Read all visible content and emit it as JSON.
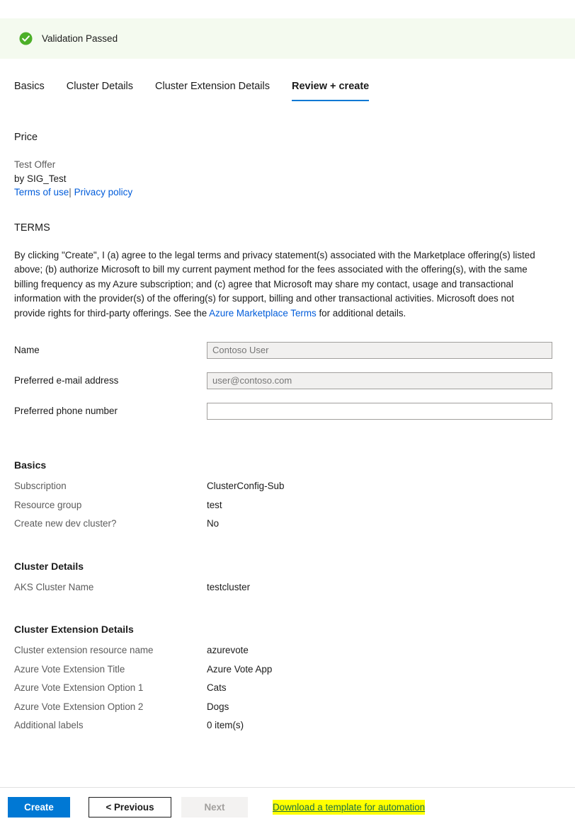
{
  "banner": {
    "icon": "check-circle-icon",
    "message": "Validation Passed",
    "background_color": "#f4faef",
    "icon_color": "#4caf28"
  },
  "tabs": [
    {
      "label": "Basics",
      "active": false
    },
    {
      "label": "Cluster Details",
      "active": false
    },
    {
      "label": "Cluster Extension Details",
      "active": false
    },
    {
      "label": "Review + create",
      "active": true
    }
  ],
  "accent_color": "#0078d4",
  "price": {
    "heading": "Price",
    "offer_name": "Test Offer",
    "publisher": "by SIG_Test",
    "terms_of_use_link": "Terms of use",
    "separator": "|",
    "privacy_policy_link": "Privacy policy"
  },
  "terms": {
    "heading": "TERMS",
    "paragraph_part1": "By clicking \"Create\", I (a) agree to the legal terms and privacy statement(s) associated with the Marketplace offering(s) listed above; (b) authorize Microsoft to bill my current payment method for the fees associated with the offering(s), with the same billing frequency as my Azure subscription; and (c) agree that Microsoft may share my contact, usage and transactional information with the provider(s) of the offering(s) for support, billing and other transactional activities. Microsoft does not provide rights for third-party offerings. See the ",
    "marketplace_terms_link": "Azure Marketplace Terms",
    "paragraph_part2": " for additional details."
  },
  "form": {
    "fields": [
      {
        "label": "Name",
        "value": "",
        "placeholder": "Contoso User",
        "readonly": true
      },
      {
        "label": "Preferred e-mail address",
        "value": "",
        "placeholder": "user@contoso.com",
        "readonly": true
      },
      {
        "label": "Preferred phone number",
        "value": "",
        "placeholder": "",
        "readonly": false
      }
    ]
  },
  "summary": {
    "sections": [
      {
        "title": "Basics",
        "rows": [
          {
            "key": "Subscription",
            "value": "ClusterConfig-Sub"
          },
          {
            "key": "Resource group",
            "value": "test"
          },
          {
            "key": "Create new dev cluster?",
            "value": "No"
          }
        ]
      },
      {
        "title": "Cluster Details",
        "rows": [
          {
            "key": "AKS Cluster Name",
            "value": "testcluster"
          }
        ]
      },
      {
        "title": "Cluster Extension Details",
        "rows": [
          {
            "key": "Cluster extension resource name",
            "value": "azurevote"
          },
          {
            "key": "Azure Vote Extension Title",
            "value": "Azure Vote App"
          },
          {
            "key": "Azure Vote Extension Option 1",
            "value": "Cats"
          },
          {
            "key": "Azure Vote Extension Option 2",
            "value": "Dogs"
          },
          {
            "key": "Additional labels",
            "value": "0 item(s)"
          }
        ]
      }
    ]
  },
  "footer": {
    "create_label": "Create",
    "previous_label": "< Previous",
    "next_label": "Next",
    "next_disabled": true,
    "download_label": "Download a template for automation",
    "download_highlight_color": "#ffff00",
    "download_text_color": "#1d6f42"
  }
}
